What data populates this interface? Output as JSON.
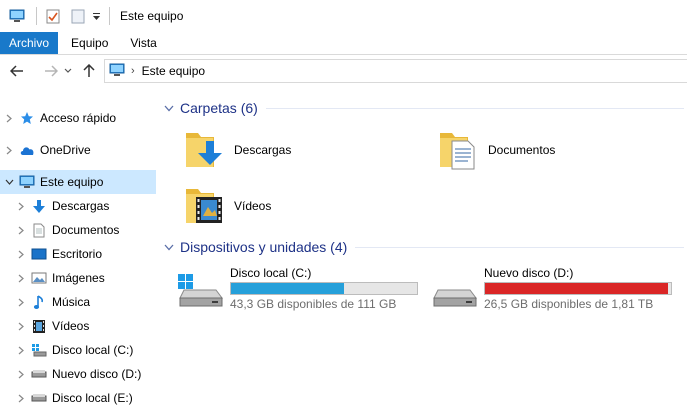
{
  "window": {
    "title": "Este equipo"
  },
  "ribbon": {
    "tabs": [
      "Archivo",
      "Equipo",
      "Vista"
    ]
  },
  "address": {
    "crumb": "Este equipo"
  },
  "sidebar": {
    "items": [
      {
        "label": "Acceso rápido",
        "icon": "star-icon",
        "level": 0,
        "selected": false
      },
      {
        "label": "OneDrive",
        "icon": "cloud-icon",
        "level": 0,
        "selected": false
      },
      {
        "label": "Este equipo",
        "icon": "computer-icon",
        "level": 0,
        "selected": true
      },
      {
        "label": "Descargas",
        "icon": "download-arrow-icon",
        "level": 1,
        "selected": false
      },
      {
        "label": "Documentos",
        "icon": "document-icon",
        "level": 1,
        "selected": false
      },
      {
        "label": "Escritorio",
        "icon": "desktop-icon",
        "level": 1,
        "selected": false
      },
      {
        "label": "Imágenes",
        "icon": "pictures-icon",
        "level": 1,
        "selected": false
      },
      {
        "label": "Música",
        "icon": "music-note-icon",
        "level": 1,
        "selected": false
      },
      {
        "label": "Vídeos",
        "icon": "film-icon",
        "level": 1,
        "selected": false
      },
      {
        "label": "Disco local (C:)",
        "icon": "system-drive-icon",
        "level": 1,
        "selected": false
      },
      {
        "label": "Nuevo disco (D:)",
        "icon": "drive-icon",
        "level": 1,
        "selected": false
      },
      {
        "label": "Disco local (E:)",
        "icon": "drive-icon",
        "level": 1,
        "selected": false
      }
    ]
  },
  "folders": {
    "header": "Carpetas (6)",
    "items": [
      {
        "label": "Descargas",
        "icon": "downloads-folder-icon"
      },
      {
        "label": "Documentos",
        "icon": "documents-folder-icon"
      },
      {
        "label": "Vídeos",
        "icon": "videos-folder-icon"
      }
    ]
  },
  "devices": {
    "header": "Dispositivos y unidades (4)",
    "items": [
      {
        "name": "Disco local (C:)",
        "free": "43,3 GB disponibles de 111 GB",
        "used_fraction": 0.61,
        "bar_color": "#26a0da",
        "icon": "system-drive-icon"
      },
      {
        "name": "Nuevo disco (D:)",
        "free": "26,5 GB disponibles de 1,81 TB",
        "used_fraction": 0.986,
        "bar_color": "#da2626",
        "icon": "drive-icon"
      }
    ]
  },
  "colors": {
    "accent": "#1979ca",
    "selection": "#cce8ff",
    "group_title": "#1e3287"
  }
}
